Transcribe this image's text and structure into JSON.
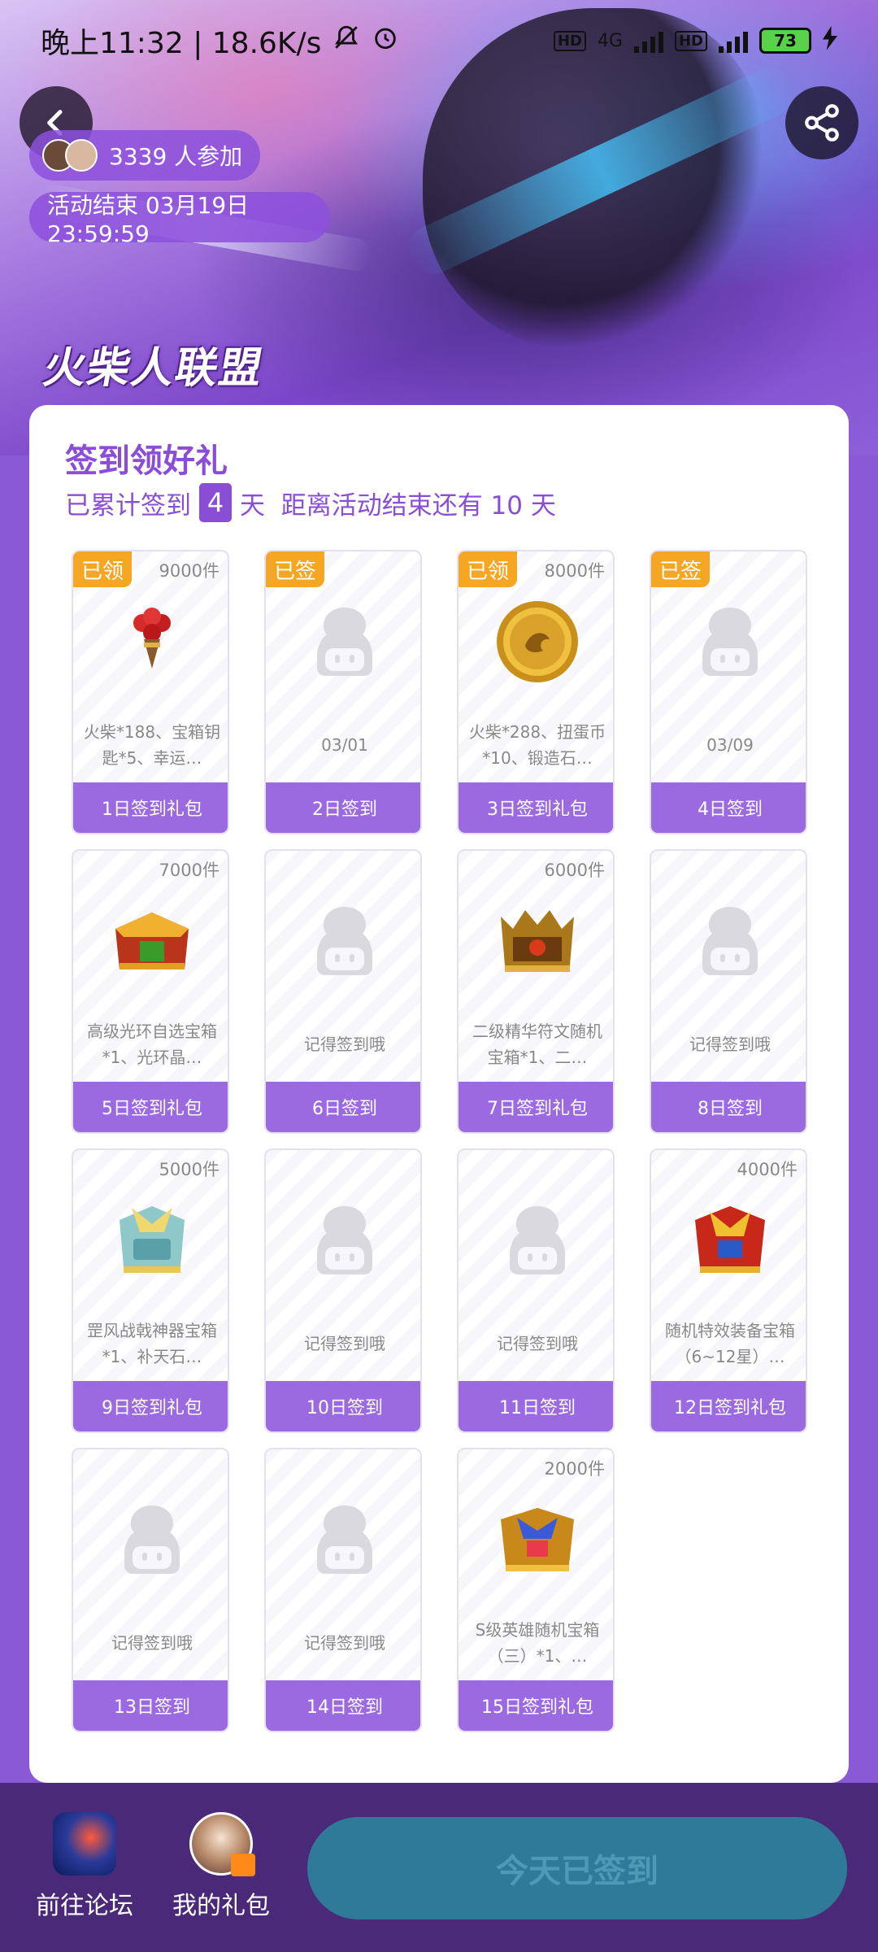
{
  "status_bar": {
    "time_speed": "晚上11:32 | 18.6K/s",
    "hd1": "HD",
    "net": "4G",
    "hd2": "HD",
    "battery": "73"
  },
  "header": {
    "participants": "3339 人参加",
    "end_time": "活动结束 03月19日 23:59:59",
    "game_logo": "火柴人联盟"
  },
  "signin": {
    "title": "签到领好礼",
    "sub_prefix": "已累计签到",
    "days": "4",
    "sub_suffix": "天  距离活动结束还有 10 天"
  },
  "tiles": [
    {
      "badge": "已领",
      "count": "9000件",
      "icon": "firework-icon",
      "desc": "火柴*188、宝箱钥匙*5、幸运…",
      "label": "1日签到礼包"
    },
    {
      "badge": "已签",
      "count": "",
      "icon": "mascot-placeholder-icon",
      "desc": "03/01",
      "label": "2日签到"
    },
    {
      "badge": "已领",
      "count": "8000件",
      "icon": "gold-coin-icon",
      "desc": "火柴*288、扭蛋币*10、锻造石…",
      "label": "3日签到礼包"
    },
    {
      "badge": "已签",
      "count": "",
      "icon": "mascot-placeholder-icon",
      "desc": "03/09",
      "label": "4日签到"
    },
    {
      "badge": "",
      "count": "7000件",
      "icon": "treasure-chest-icon",
      "desc": "高级光环自选宝箱*1、光环晶…",
      "label": "5日签到礼包"
    },
    {
      "badge": "",
      "count": "",
      "icon": "mascot-placeholder-icon",
      "desc": "记得签到哦",
      "label": "6日签到"
    },
    {
      "badge": "",
      "count": "6000件",
      "icon": "rune-chest-icon",
      "desc": "二级精华符文随机宝箱*1、二…",
      "label": "7日签到礼包"
    },
    {
      "badge": "",
      "count": "",
      "icon": "mascot-placeholder-icon",
      "desc": "记得签到哦",
      "label": "8日签到"
    },
    {
      "badge": "",
      "count": "5000件",
      "icon": "artifact-chest-icon",
      "desc": "罡风战戟神器宝箱*1、补天石…",
      "label": "9日签到礼包"
    },
    {
      "badge": "",
      "count": "",
      "icon": "mascot-placeholder-icon",
      "desc": "记得签到哦",
      "label": "10日签到"
    },
    {
      "badge": "",
      "count": "",
      "icon": "mascot-placeholder-icon",
      "desc": "记得签到哦",
      "label": "11日签到"
    },
    {
      "badge": "",
      "count": "4000件",
      "icon": "equipment-chest-icon",
      "desc": "随机特效装备宝箱（6~12星）…",
      "label": "12日签到礼包"
    },
    {
      "badge": "",
      "count": "",
      "icon": "mascot-placeholder-icon",
      "desc": "记得签到哦",
      "label": "13日签到"
    },
    {
      "badge": "",
      "count": "",
      "icon": "mascot-placeholder-icon",
      "desc": "记得签到哦",
      "label": "14日签到"
    },
    {
      "badge": "",
      "count": "2000件",
      "icon": "hero-chest-icon",
      "desc": "S级英雄随机宝箱（三）*1、…",
      "label": "15日签到礼包"
    }
  ],
  "bottom": {
    "forum": "前往论坛",
    "gifts": "我的礼包",
    "checkin": "今天已签到"
  },
  "colors": {
    "accent": "#8a4ed6",
    "badge": "#f5a623",
    "tile_footer": "#9c6ae0",
    "checkin_button": "#2f7a98",
    "bottom_bar": "#4a2a78"
  }
}
